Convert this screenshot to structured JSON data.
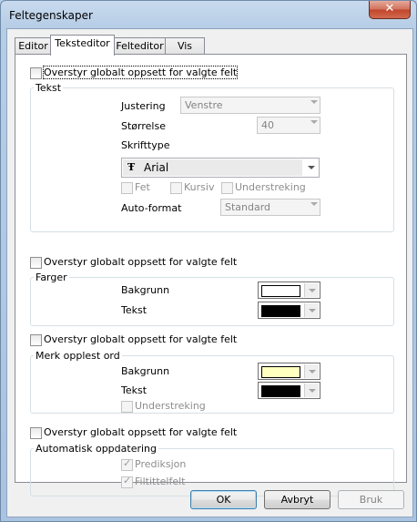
{
  "window": {
    "title": "Feltegenskaper",
    "close": "✕"
  },
  "tabs": [
    {
      "label": "Editor"
    },
    {
      "label": "Teksteditor"
    },
    {
      "label": "Felteditor"
    },
    {
      "label": "Vis"
    }
  ],
  "override_label": "Overstyr globalt oppsett for valgte felt",
  "text_group": {
    "title": "Tekst",
    "alignment_label": "Justering",
    "alignment_value": "Venstre",
    "size_label": "Størrelse",
    "size_value": "40",
    "font_label": "Skrifttype",
    "font_value": "Arial",
    "bold": "Fet",
    "italic": "Kursiv",
    "underline": "Understreking",
    "autoformat_label": "Auto-format",
    "autoformat_value": "Standard"
  },
  "colors_group": {
    "title": "Farger",
    "background_label": "Bakgrunn",
    "background_color": "#ffffff",
    "text_label": "Tekst",
    "text_color": "#000000"
  },
  "highlight_group": {
    "title": "Merk opplest ord",
    "background_label": "Bakgrunn",
    "background_color": "#ffffc0",
    "text_label": "Tekst",
    "text_color": "#000000",
    "underline": "Understreking"
  },
  "auto_group": {
    "title": "Automatisk oppdatering",
    "prediction": "Prediksjon",
    "filetitle": "Filtittelfelt"
  },
  "buttons": {
    "ok": "OK",
    "cancel": "Avbryt",
    "apply": "Bruk"
  }
}
